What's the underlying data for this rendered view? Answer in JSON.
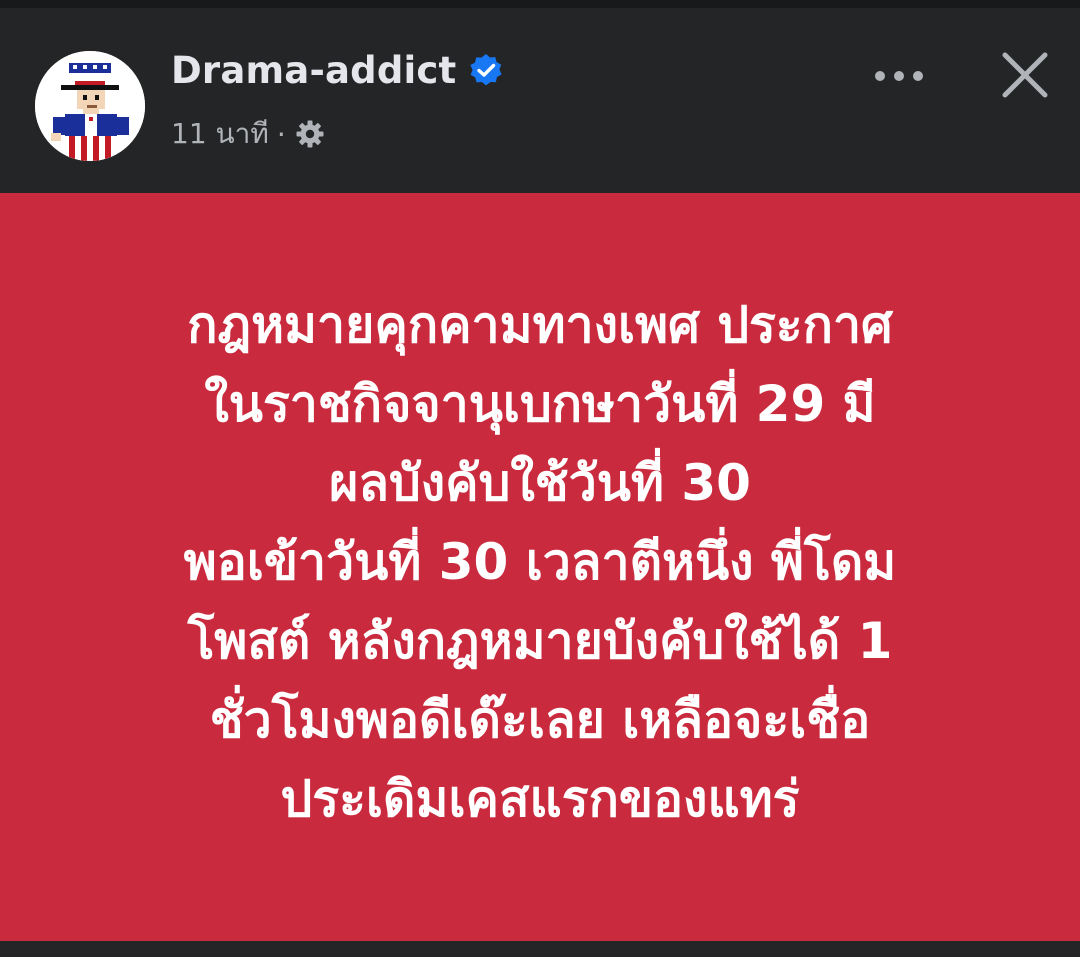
{
  "post": {
    "author_name": "Drama-addict",
    "timestamp": "11 นาที",
    "separator": "·",
    "privacy_icon": "gear-icon",
    "verified_icon": "verified-badge-icon",
    "more_icon": "more-horizontal-icon",
    "close_icon": "close-icon",
    "card_background": "#ca2a3d",
    "verified_color": "#1877f2",
    "lines": [
      "กฎหมายคุกคามทางเพศ ประกาศ",
      "ในราชกิจจานุเบกษาวันที่ 29 มี",
      "ผลบังคับใช้วันที่ 30",
      "พอเข้าวันที่ 30 เวลาตีหนึ่ง พี่โดม",
      "โพสต์ หลังกฎหมายบังคับใช้ได้ 1",
      "ชั่วโมงพอดีเด๊ะเลย เหลือจะเชื่อ",
      "ประเดิมเคสแรกของแทร่"
    ]
  }
}
